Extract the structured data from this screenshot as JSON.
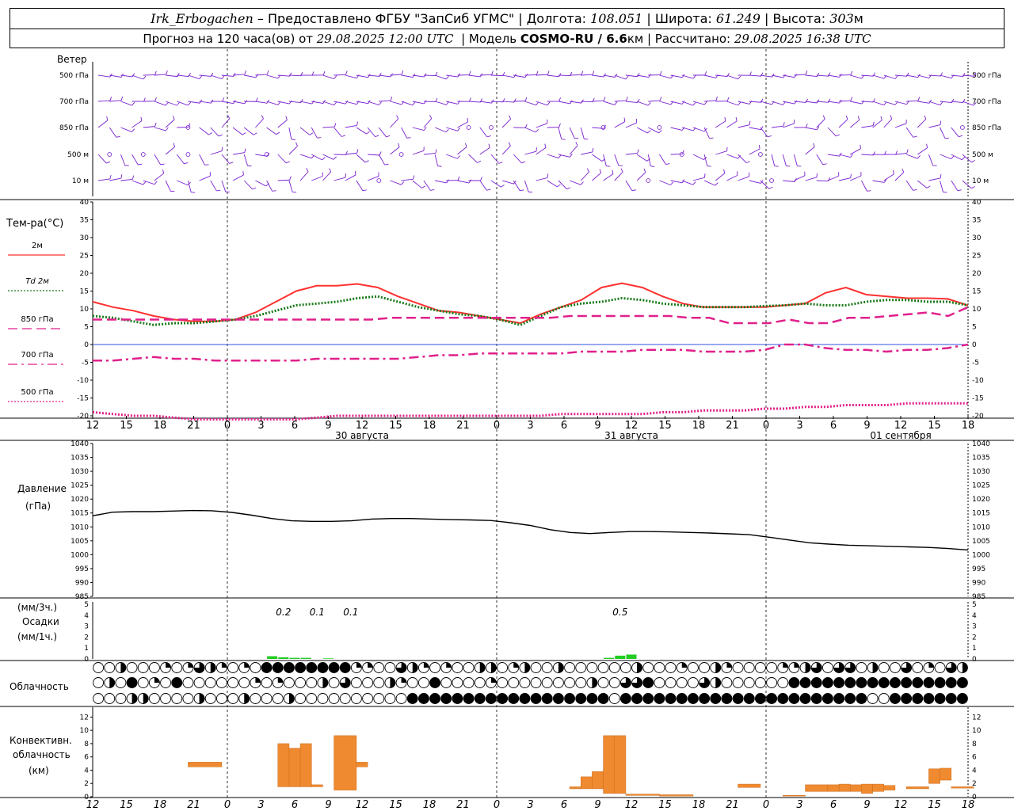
{
  "header": {
    "station": "Irk_Erbogachen",
    "provider": " – Предоставлено ФГБУ \"ЗапСиб УГМС\" | Долгота: ",
    "lon": "108.051",
    "lat_label": " | Широта: ",
    "lat": "61.249",
    "alt_label": " | Высота: ",
    "alt": "303",
    "alt_unit": "м",
    "forecast_prefix": "Прогноз на 120 часа(ов) от ",
    "forecast_time": "29.08.2025 12:00 UTC",
    "model_label": "  | Модель ",
    "model": "COSMO-RU / 6.6",
    "model_unit": "км",
    "calc_label": " | Рассчитано: ",
    "calc_time": "29.08.2025 16:38 UTC"
  },
  "panels": {
    "wind": {
      "title": "Ветер",
      "levels": [
        "500 гПа",
        "700 гПа",
        "850 гПа",
        "500 м",
        "10  м"
      ],
      "right_levels": [
        "500 гПа",
        "700 гПа",
        "850 гПа",
        "500 м",
        "10  м"
      ]
    },
    "temp": {
      "title": "Тем-ра(°C)",
      "legend": [
        {
          "name": "2м",
          "color": "#ff3030",
          "style": "solid"
        },
        {
          "name": "Td  2м",
          "color": "#1a7a1a",
          "style": "dotted"
        },
        {
          "name": "850 гПа",
          "color": "#e0208a",
          "style": "longdash"
        },
        {
          "name": "700 гПа",
          "color": "#e0208a",
          "style": "dashdot"
        },
        {
          "name": "500 гПа",
          "color": "#e0208a",
          "style": "dotted"
        }
      ]
    },
    "pressure": {
      "title": "Давление",
      "unit": "(гПа)"
    },
    "precip": {
      "title": "Осадки",
      "unit_top": "(мм/3ч.)",
      "unit_bottom": "(мм/1ч.)",
      "labels": [
        "0.2",
        "0.1",
        "0.1",
        "0.5"
      ]
    },
    "cloud": {
      "title": "Облачность"
    },
    "conv": {
      "title_lines": [
        "Конвективн.",
        "облачность",
        "(км)"
      ]
    }
  },
  "time_axis": {
    "hour_labels": [
      "12",
      "15",
      "18",
      "21",
      "0",
      "3",
      "6",
      "9",
      "12",
      "15",
      "18",
      "21",
      "0",
      "3",
      "6",
      "9",
      "12",
      "15",
      "18",
      "21",
      "0",
      "3",
      "6",
      "9",
      "12",
      "15",
      "18"
    ],
    "date_labels": [
      "30 августа",
      "31 августа",
      "01 сентября"
    ]
  },
  "chart_data": [
    {
      "type": "line",
      "title": "Тем-ра(°C)",
      "x_hours": [
        0,
        3,
        6,
        9,
        12,
        15,
        18,
        21,
        24,
        27,
        30,
        33,
        36,
        39,
        42,
        45,
        48,
        51,
        54,
        57,
        60,
        63,
        66,
        69,
        72,
        75,
        78,
        81,
        84,
        87,
        90,
        93,
        96,
        99,
        102,
        105,
        108,
        111,
        114,
        117,
        120,
        123,
        126
      ],
      "ylim": [
        -20,
        40
      ],
      "yticks": [
        -20,
        -15,
        -10,
        -5,
        0,
        5,
        10,
        15,
        20,
        25,
        30,
        35,
        40
      ],
      "series": [
        {
          "name": "2м",
          "values": [
            12,
            10.5,
            9.5,
            8,
            7,
            6.5,
            6.5,
            7,
            9,
            12,
            15,
            16.5,
            16.5,
            17,
            16,
            13.5,
            11.5,
            9.5,
            9,
            8,
            7,
            6,
            8.5,
            10.5,
            12.5,
            16,
            17.2,
            16,
            13.5,
            11.5,
            10.5,
            10.5,
            10.5,
            10.5,
            11,
            11.5,
            14.5,
            16,
            14,
            13.5,
            13,
            13,
            12.8,
            11
          ]
        },
        {
          "name": "Td  2м",
          "values": [
            8,
            7.5,
            6.5,
            5.5,
            6,
            6,
            6.5,
            7,
            8,
            9.5,
            11,
            11.5,
            12,
            13,
            13.5,
            12,
            10.5,
            9.5,
            8.5,
            8,
            7,
            5.5,
            8,
            10.5,
            11.5,
            12,
            13,
            12.5,
            11.5,
            11,
            10.5,
            10.5,
            10.5,
            10.8,
            11,
            11.5,
            11,
            11,
            12,
            12.5,
            12.5,
            12,
            12,
            11
          ]
        },
        {
          "name": "850 гПа",
          "values": [
            7,
            7,
            7,
            7,
            7,
            7,
            7,
            7,
            7,
            7,
            7,
            7,
            7,
            7,
            7,
            7.5,
            7.5,
            7.5,
            7.5,
            7.5,
            7.5,
            7.5,
            7.5,
            7.5,
            8,
            8,
            8,
            8,
            8,
            8,
            7.5,
            7.5,
            6,
            6,
            6,
            7,
            6,
            6,
            7.5,
            7.5,
            8,
            8.5,
            9,
            8,
            10.5
          ]
        },
        {
          "name": "700 гПа",
          "values": [
            -4.5,
            -4.5,
            -4,
            -3.5,
            -4,
            -4,
            -4.5,
            -4.5,
            -4.5,
            -4.5,
            -4.5,
            -4,
            -4,
            -4,
            -4,
            -4,
            -3.5,
            -3,
            -3,
            -2.5,
            -2.5,
            -2.5,
            -2.5,
            -2.5,
            -2,
            -2,
            -2,
            -1.5,
            -1.5,
            -1.5,
            -2,
            -2,
            -2,
            -1.5,
            0,
            0,
            -1,
            -1.5,
            -1.5,
            -2,
            -1.5,
            -1.5,
            -1,
            0
          ]
        },
        {
          "name": "500 гПа",
          "values": [
            -19,
            -19.5,
            -20,
            -20,
            -20.5,
            -21,
            -21,
            -21,
            -21,
            -21,
            -21,
            -20.5,
            -20,
            -20,
            -20,
            -20,
            -20,
            -20,
            -20,
            -20,
            -20,
            -20,
            -20,
            -19.5,
            -19.5,
            -19.5,
            -19.5,
            -19.5,
            -19,
            -19,
            -18.5,
            -18.5,
            -18.5,
            -18,
            -18,
            -17.5,
            -17.5,
            -17,
            -17,
            -17,
            -16.5,
            -16.5,
            -16.5,
            -16.5
          ]
        }
      ]
    },
    {
      "type": "line",
      "title": "Давление",
      "ylabel": "(гПа)",
      "x_hours": [
        0,
        3,
        6,
        9,
        12,
        15,
        18,
        21,
        24,
        27,
        30,
        33,
        36,
        39,
        42,
        45,
        48,
        51,
        54,
        57,
        60,
        63,
        66,
        69,
        72,
        75,
        78,
        81,
        84,
        87,
        90,
        93,
        96,
        99,
        102,
        105,
        108,
        111,
        114,
        117,
        120
      ],
      "ylim": [
        985,
        1040
      ],
      "yticks": [
        985,
        990,
        995,
        1000,
        1005,
        1010,
        1015,
        1020,
        1025,
        1030,
        1035,
        1040
      ],
      "series": [
        {
          "name": "",
          "values": [
            1014,
            1015.3,
            1015.5,
            1015.5,
            1015.7,
            1015.9,
            1015.8,
            1015.2,
            1014.2,
            1013,
            1012.2,
            1012,
            1012,
            1012.2,
            1012.8,
            1013,
            1013,
            1012.8,
            1012.6,
            1012.5,
            1012.3,
            1011.5,
            1010.5,
            1009,
            1008,
            1007.6,
            1008,
            1008.3,
            1008.3,
            1008.2,
            1008,
            1007.8,
            1007.5,
            1007.2,
            1006.3,
            1005.3,
            1004.3,
            1003.8,
            1003.4,
            1003.2,
            1003,
            1002.8,
            1002.6,
            1002.2,
            1001.7
          ]
        }
      ]
    },
    {
      "type": "bar",
      "title": "Осадки",
      "x_hours": [
        15,
        16,
        17,
        18,
        19,
        20,
        21,
        22,
        23,
        24,
        25,
        26,
        27,
        28,
        29,
        30,
        31,
        32,
        33,
        34,
        35,
        36,
        37,
        38,
        39,
        40,
        41,
        42,
        43,
        44,
        45,
        46,
        47,
        48,
        49,
        50,
        51,
        52,
        53,
        54,
        55,
        56,
        57,
        58,
        59,
        60,
        61,
        62,
        63,
        64,
        65,
        66,
        67,
        68,
        69,
        70,
        71,
        72
      ],
      "ylim": [
        0,
        5
      ],
      "labelled_3h_totals": [
        {
          "hour": 17,
          "value": 0.2
        },
        {
          "hour": 20,
          "value": 0.1
        },
        {
          "hour": 23,
          "value": 0.1
        },
        {
          "hour": 47,
          "value": 0.5
        }
      ],
      "hourly_mm": [
        {
          "hour": 16,
          "value": 0.25
        },
        {
          "hour": 17,
          "value": 0.15
        },
        {
          "hour": 18,
          "value": 0.1
        },
        {
          "hour": 19,
          "value": 0.1
        },
        {
          "hour": 21,
          "value": 0.05
        },
        {
          "hour": 46,
          "value": 0.1
        },
        {
          "hour": 47,
          "value": 0.3
        },
        {
          "hour": 48,
          "value": 0.4
        }
      ]
    },
    {
      "type": "bar",
      "title": "Конвективн. облачность (км)",
      "ylim": [
        0,
        13
      ],
      "yticks": [
        0,
        2,
        4,
        6,
        8,
        10,
        12
      ],
      "segments_hours_km": [
        {
          "x0": 8.5,
          "x1": 11.5,
          "base": 4.5,
          "top": 5.2
        },
        {
          "x0": 16.5,
          "x1": 17.5,
          "base": 1.5,
          "top": 8.0
        },
        {
          "x0": 17.5,
          "x1": 18.5,
          "base": 1.5,
          "top": 7.3
        },
        {
          "x0": 18.5,
          "x1": 19.5,
          "base": 1.5,
          "top": 8.0
        },
        {
          "x0": 19.5,
          "x1": 20.5,
          "base": 1.5,
          "top": 1.8
        },
        {
          "x0": 21.5,
          "x1": 23.5,
          "base": 1.0,
          "top": 9.2
        },
        {
          "x0": 23.5,
          "x1": 24.5,
          "base": 4.5,
          "top": 5.2
        },
        {
          "x0": 42.5,
          "x1": 43.5,
          "base": 1.2,
          "top": 1.5
        },
        {
          "x0": 43.5,
          "x1": 44.5,
          "base": 1.2,
          "top": 3.0
        },
        {
          "x0": 44.5,
          "x1": 45.5,
          "base": 1.2,
          "top": 3.8
        },
        {
          "x0": 45.5,
          "x1": 46.5,
          "base": 0.5,
          "top": 9.2
        },
        {
          "x0": 46.5,
          "x1": 47.5,
          "base": 0.5,
          "top": 9.2
        },
        {
          "x0": 47.5,
          "x1": 50.5,
          "base": 0.2,
          "top": 0.4
        },
        {
          "x0": 50.5,
          "x1": 53.5,
          "base": 0.1,
          "top": 0.3
        },
        {
          "x0": 57.5,
          "x1": 59.5,
          "base": 1.4,
          "top": 1.9
        },
        {
          "x0": 61.5,
          "x1": 63.5,
          "base": 0.1,
          "top": 0.2
        },
        {
          "x0": 63.5,
          "x1": 65.5,
          "base": 0.8,
          "top": 1.8
        },
        {
          "x0": 65.5,
          "x1": 66.5,
          "base": 0.8,
          "top": 1.8
        },
        {
          "x0": 66.5,
          "x1": 67.5,
          "base": 0.8,
          "top": 1.9
        },
        {
          "x0": 67.5,
          "x1": 68.5,
          "base": 0.8,
          "top": 1.8
        },
        {
          "x0": 68.5,
          "x1": 69.5,
          "base": 0.5,
          "top": 1.9
        },
        {
          "x0": 69.5,
          "x1": 70.5,
          "base": 0.8,
          "top": 1.9
        },
        {
          "x0": 70.5,
          "x1": 71.5,
          "base": 1.0,
          "top": 1.7
        },
        {
          "x0": 72.5,
          "x1": 74.5,
          "base": 1.2,
          "top": 1.5
        },
        {
          "x0": 74.5,
          "x1": 75.5,
          "base": 2.0,
          "top": 4.2
        },
        {
          "x0": 75.5,
          "x1": 76.5,
          "base": 2.5,
          "top": 4.3
        },
        {
          "x0": 76.5,
          "x1": 78.5,
          "base": 1.3,
          "top": 1.5
        }
      ]
    }
  ],
  "colors": {
    "wind": "#7a20d0",
    "temp2m": "#ff3030",
    "td": "#1a7a1a",
    "mag": "#e0208a",
    "precip": "#22cc22",
    "conv": "#f08a30",
    "zero": "#3050e0"
  }
}
